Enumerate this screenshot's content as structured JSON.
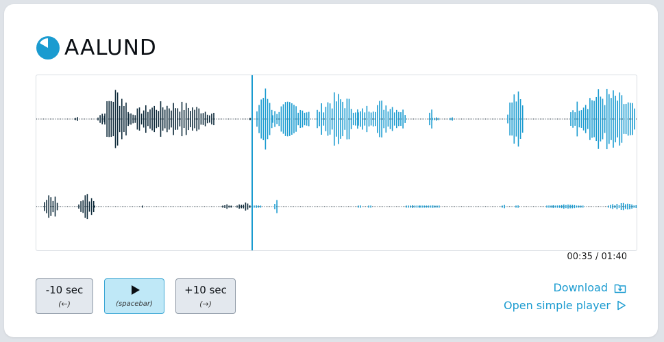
{
  "brand": {
    "name": "AALUND",
    "logo_icon": "pie-clock-logo",
    "accent": "#1a9bd0"
  },
  "player": {
    "current_time": "00:35",
    "duration": "01:40",
    "time_display": "00:35 / 01:40",
    "progress_fraction": 0.35,
    "played_color": "#0e2a3a",
    "remaining_color": "#1a9bd0"
  },
  "controls": {
    "back": {
      "label": "-10 sec",
      "hint": "(←)"
    },
    "play": {
      "icon": "play-icon",
      "hint": "(spacebar)"
    },
    "forward": {
      "label": "+10 sec",
      "hint": "(→)"
    }
  },
  "links": {
    "download": {
      "label": "Download",
      "icon": "download-folder-icon"
    },
    "simple_player": {
      "label": "Open simple player",
      "icon": "play-outline-icon"
    }
  }
}
